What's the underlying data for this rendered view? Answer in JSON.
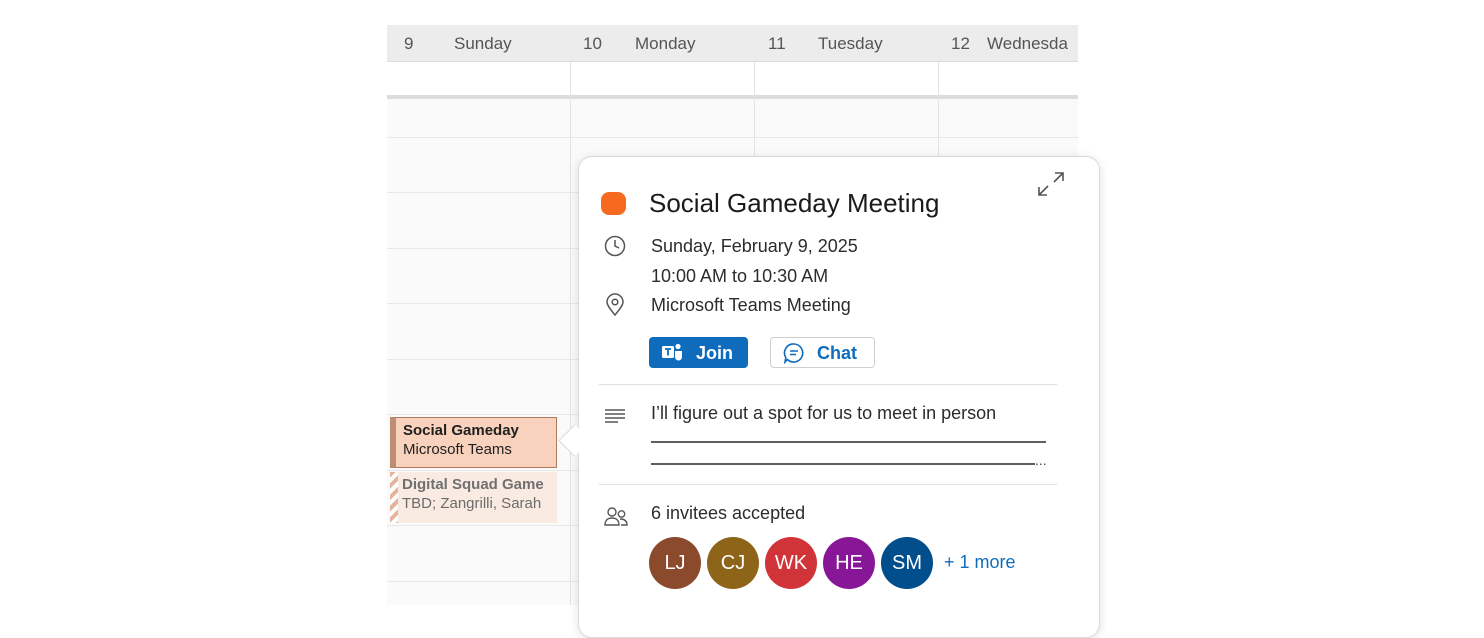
{
  "calendar": {
    "days": [
      {
        "num": "9",
        "name": "Sunday"
      },
      {
        "num": "10",
        "name": "Monday"
      },
      {
        "num": "11",
        "name": "Tuesday"
      },
      {
        "num": "12",
        "name": "Wednesda"
      }
    ],
    "events": [
      {
        "title": "Social Gameday",
        "subtitle": "Microsoft Teams"
      },
      {
        "title": "Digital Squad Game",
        "subtitle": "TBD; Zangrilli, Sarah"
      }
    ]
  },
  "popup": {
    "title": "Social Gameday Meeting",
    "category_color": "#f56a1e",
    "date": "Sunday, February 9, 2025",
    "time": "10:00 AM to 10:30 AM",
    "location": "Microsoft Teams Meeting",
    "join_label": "Join",
    "chat_label": "Chat",
    "description": "I’ll figure out a spot for us to meet in person",
    "ellipsis": "...",
    "attendees_summary": "6 invitees accepted",
    "avatars": [
      {
        "initials": "LJ",
        "color": "#8b4a2b"
      },
      {
        "initials": "CJ",
        "color": "#8e6418"
      },
      {
        "initials": "WK",
        "color": "#d13438"
      },
      {
        "initials": "HE",
        "color": "#881798"
      },
      {
        "initials": "SM",
        "color": "#004e8c"
      }
    ],
    "more_label": "+ 1 more"
  },
  "icons": {
    "expand": "expand-icon",
    "clock": "clock-icon",
    "location": "location-pin-icon",
    "teams": "teams-icon",
    "chat": "chat-bubble-icon",
    "notes": "notes-lines-icon",
    "people": "people-icon"
  }
}
